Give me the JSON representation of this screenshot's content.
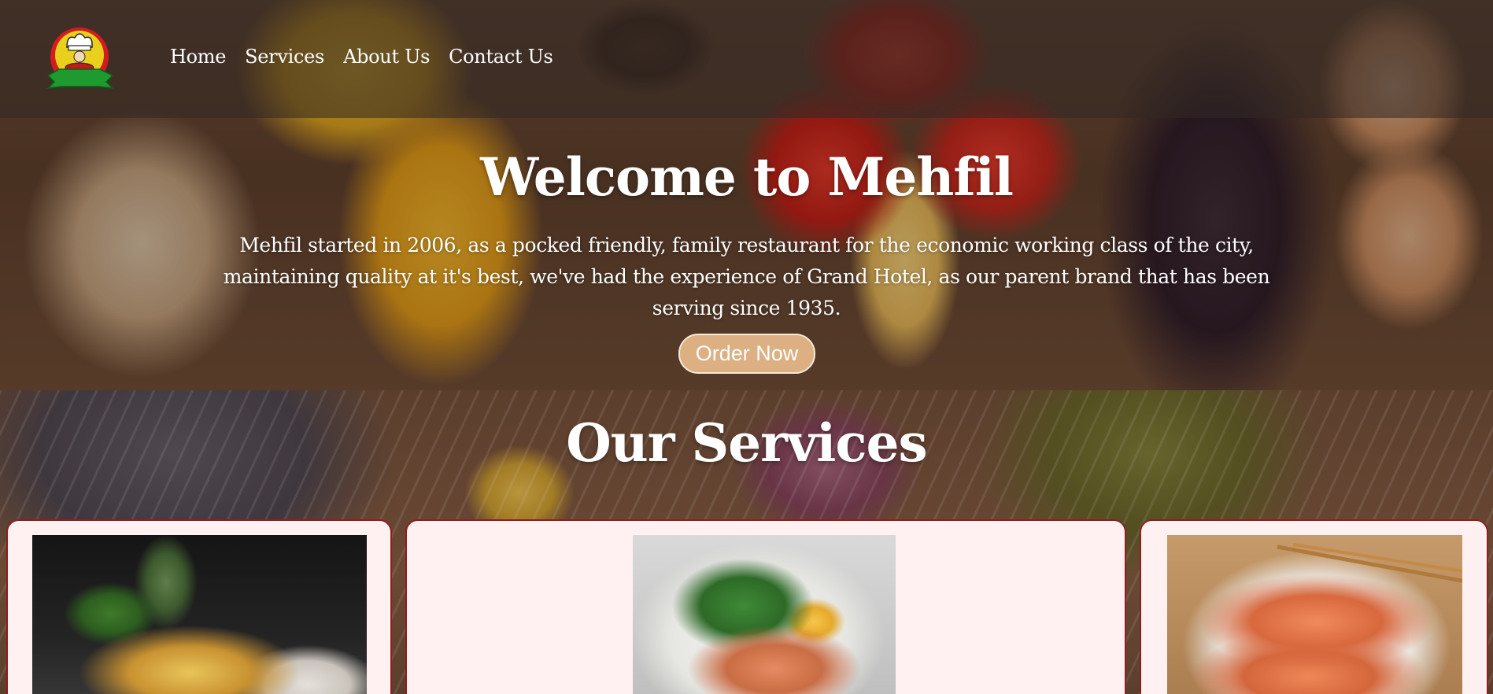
{
  "nav": {
    "logo_name": "chef-logo",
    "links": [
      {
        "label": "Home"
      },
      {
        "label": "Services"
      },
      {
        "label": "About Us"
      },
      {
        "label": "Contact Us"
      }
    ]
  },
  "hero": {
    "title": "Welcome to Mehfil",
    "description": "Mehfil started in 2006, as a pocked friendly, family restaurant for the economic working class of the city, maintaining quality at it's best, we've had the experience of Grand Hotel, as our parent brand that has been serving since 1935.",
    "cta_label": "Order Now"
  },
  "services": {
    "title": "Our Services",
    "cards": [
      {
        "image": "pizza-photo"
      },
      {
        "image": "salmon-salad-photo"
      },
      {
        "image": "sliced-salmon-photo"
      }
    ]
  },
  "colors": {
    "cta_background": "#dcb083",
    "card_background": "#fff1f1",
    "card_border": "#8e1f1f",
    "logo_banner": "#1f9a2e",
    "logo_badge": "#e8d01c"
  }
}
